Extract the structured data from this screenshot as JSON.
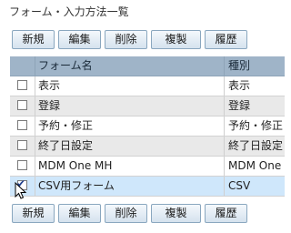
{
  "page": {
    "title": "フォーム・入力方法一覧"
  },
  "toolbar": {
    "new_label": "新規",
    "edit_label": "編集",
    "delete_label": "削除",
    "copy_label": "複製",
    "history_label": "履歴"
  },
  "table": {
    "columns": [
      "フォーム名",
      "種別"
    ],
    "rows": [
      {
        "name": "表示",
        "type": "表示",
        "checked": false
      },
      {
        "name": "登録",
        "type": "登録",
        "checked": false
      },
      {
        "name": "予約・修正",
        "type": "予約・修正",
        "checked": false
      },
      {
        "name": "終了日設定",
        "type": "終了日設定",
        "checked": false
      },
      {
        "name": "MDM One MH",
        "type": "MDM One MH",
        "checked": false
      },
      {
        "name": "CSV用フォーム",
        "type": "CSV",
        "checked": true
      }
    ]
  },
  "colors": {
    "header_bg": "#9fb4c8",
    "selected_row_bg": "#cfe7fb",
    "button_border": "#8aa7bf"
  },
  "icons": {
    "checkmark": "checkmark-icon",
    "cursor": "mouse-pointer-icon"
  }
}
